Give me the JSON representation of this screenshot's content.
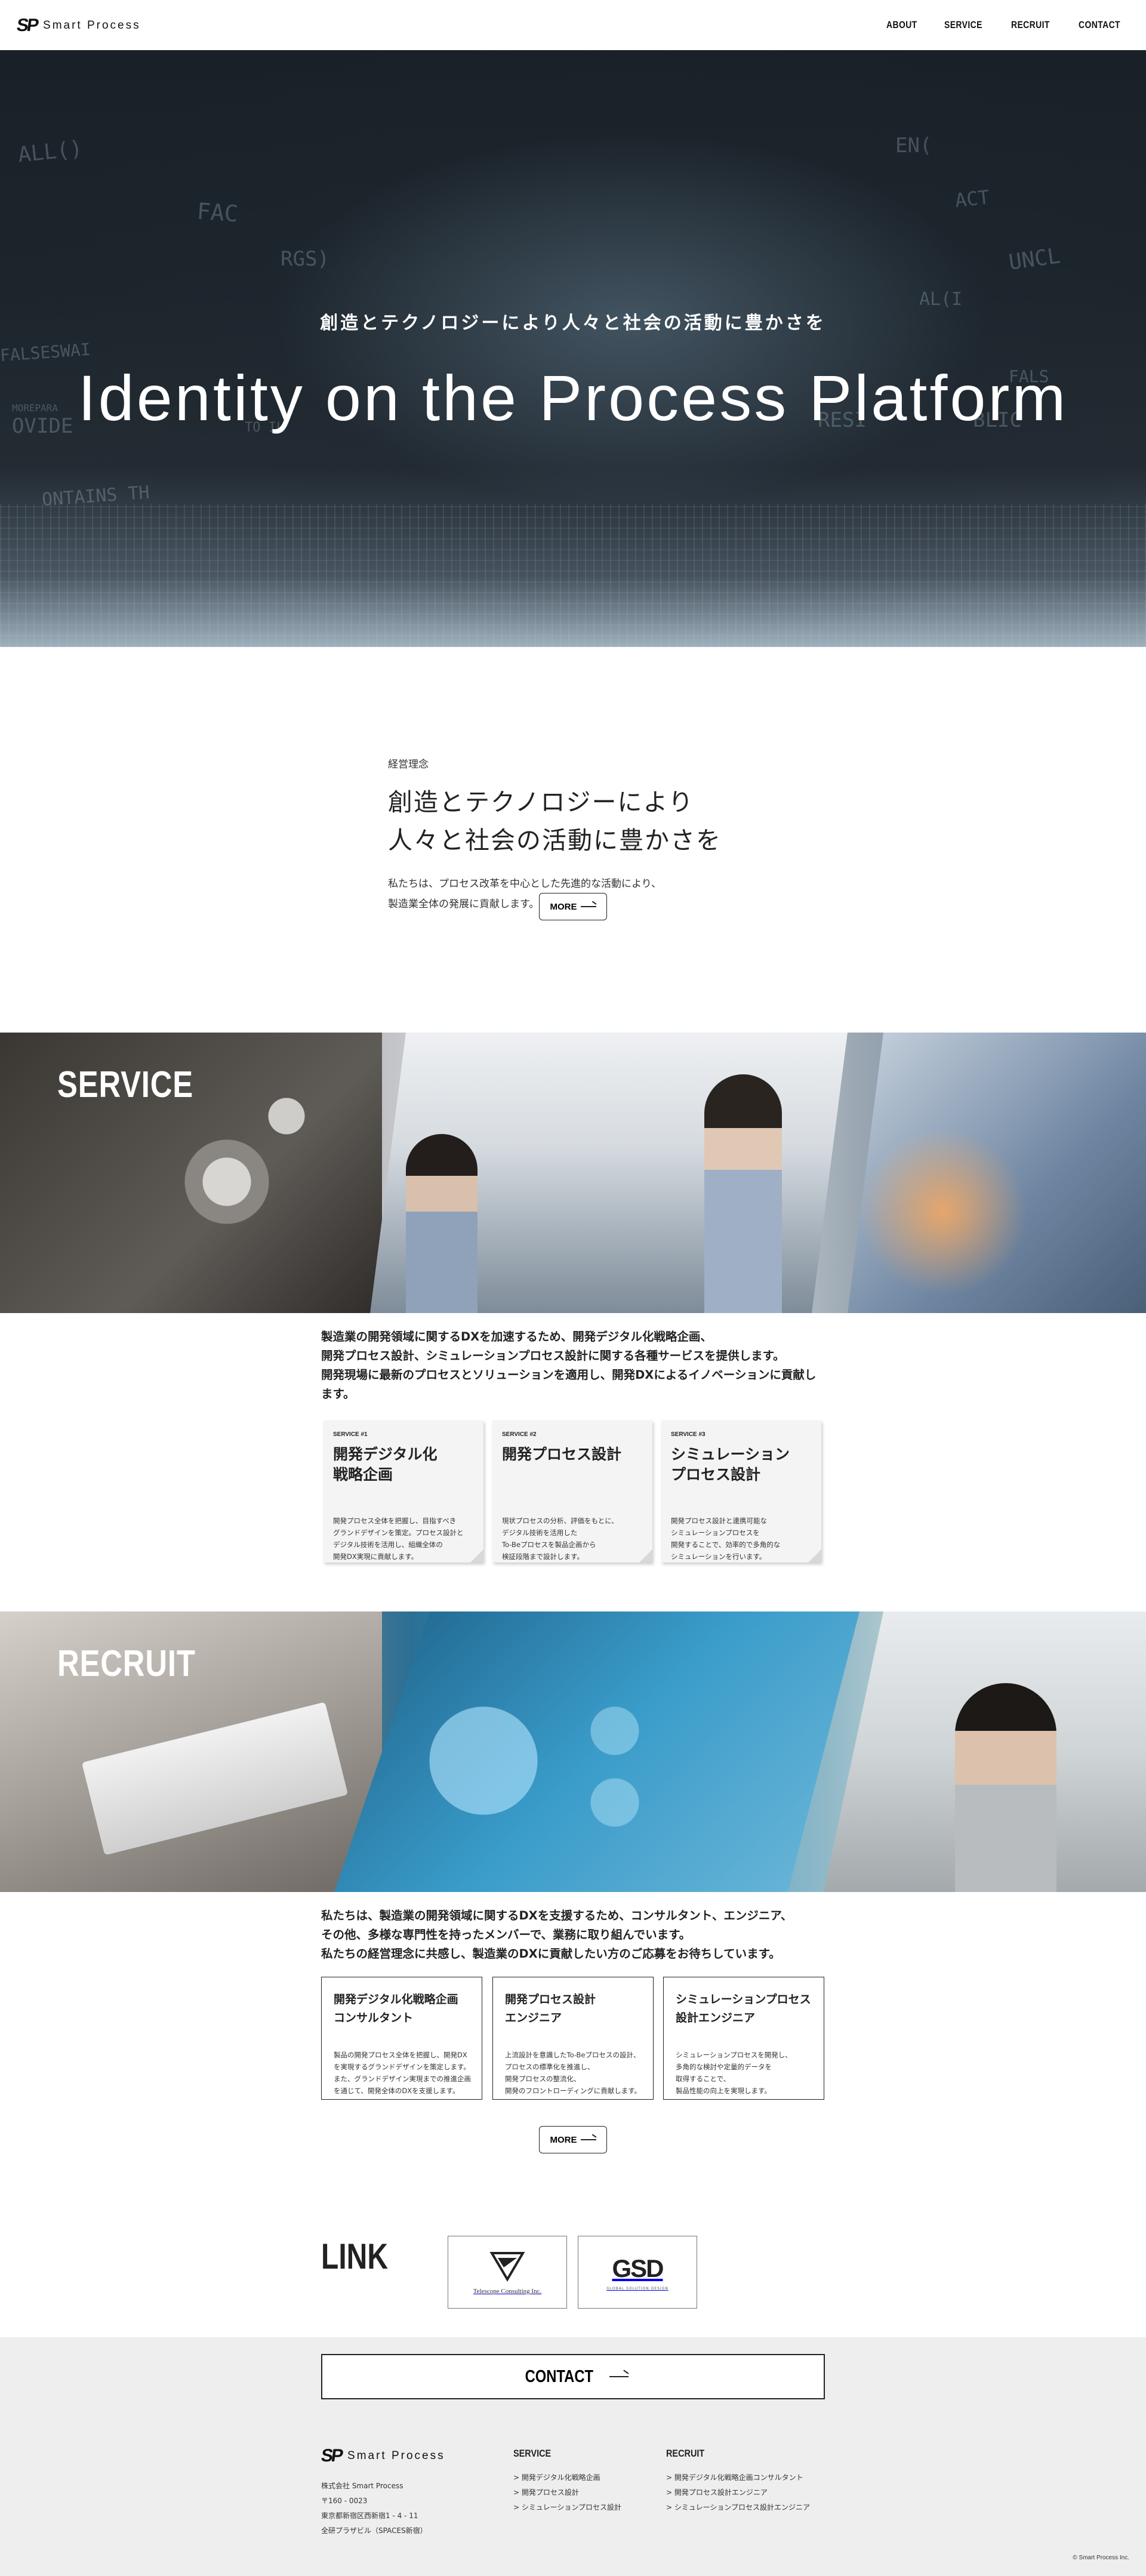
{
  "header": {
    "logo_mark": "SP",
    "logo_text": "Smart Process",
    "nav": [
      "ABOUT",
      "SERVICE",
      "RECRUIT",
      "CONTACT"
    ]
  },
  "hero": {
    "subtitle": "創造とテクノロジーにより人々と社会の活動に豊かさを",
    "title": "Identity on the Process Platform",
    "bg_text": [
      "ALL()",
      "FAC",
      "RGS)",
      "FALSESWAI",
      "OVIDE",
      "MOREPARA",
      "ONTAINS TH",
      "TO IL",
      "AL(I",
      "RESI",
      "BLIC",
      "EN(",
      "UNCL",
      "FALS",
      "ACT"
    ]
  },
  "philosophy": {
    "label": "経営理念",
    "heading_line1": "創造とテクノロジーにより",
    "heading_line2": "人々と社会の活動に豊かさを",
    "body_line1": "私たちは、プロセス改革を中心とした先進的な活動により、",
    "body_line2": "製造業全体の発展に貢献します。",
    "more_label": "MORE"
  },
  "service": {
    "banner_title": "SERVICE",
    "lead_line1": "製造業の開発領域に関するDXを加速するため、開発デジタル化戦略企画、",
    "lead_line2": "開発プロセス設計、シミュレーションプロセス設計に関する各種サービスを提供します。",
    "lead_line3": "開発現場に最新のプロセスとソリューションを適用し、開発DXによるイノベーションに貢献し",
    "lead_line4": "ます。",
    "cards": [
      {
        "num": "SERVICE #1",
        "title_line1": "開発デジタル化",
        "title_line2": "戦略企画",
        "desc": [
          "開発プロセス全体を把握し、目指すべき",
          "グランドデザインを策定。プロセス設計と",
          "デジタル技術を活用し、組織全体の",
          "開発DX実現に貢献します。"
        ]
      },
      {
        "num": "SERVICE #2",
        "title_line1": "開発プロセス設計",
        "title_line2": "",
        "desc": [
          "現状プロセスの分析、評価をもとに、",
          "デジタル技術を活用した",
          "To-Beプロセスを製品企画から",
          "検証段階まで設計します。"
        ]
      },
      {
        "num": "SERVICE #3",
        "title_line1": "シミュレーション",
        "title_line2": "プロセス設計",
        "desc": [
          "開発プロセス設計と連携可能な",
          "シミュレーションプロセスを",
          "開発することで、効率的で多角的な",
          "シミュレーションを行います。"
        ]
      }
    ]
  },
  "recruit": {
    "banner_title": "RECRUIT",
    "lead_line1": "私たちは、製造業の開発領域に関するDXを支援するため、コンサルタント、エンジニア、",
    "lead_line2": "その他、多様な専門性を持ったメンバーで、業務に取り組んでいます。",
    "lead_line3": "私たちの経営理念に共感し、製造業のDXに貢献したい方のご応募をお待ちしています。",
    "jobs": [
      {
        "title_line1": "開発デジタル化戦略企画",
        "title_line2": "コンサルタント",
        "desc": [
          "製品の開発プロセス全体を把握し、開発DX",
          "を実現するグランドデザインを策定します。",
          "また、グランドデザイン実現までの推進企画",
          "を通じて、開発全体のDXを支援します。"
        ]
      },
      {
        "title_line1": "開発プロセス設計",
        "title_line2": "エンジニア",
        "desc": [
          "上流設計を意識したTo-Beプロセスの設計、",
          "プロセスの標準化を推進し、",
          "開発プロセスの整流化、",
          "開発のフロントローディングに貢献します。"
        ]
      },
      {
        "title_line1": "シミュレーションプロセス",
        "title_line2": "設計エンジニア",
        "desc": [
          "シミュレーションプロセスを開発し、",
          "多角的な検討や定量的データを",
          "取得することで、",
          "製品性能の向上を実現します。"
        ]
      }
    ],
    "more_label": "MORE"
  },
  "link": {
    "title": "LINK",
    "partners": [
      {
        "name": "Telescope Consulting Inc."
      },
      {
        "name": "GSD",
        "sub": "GLOBAL SOLUTION DESIGN"
      }
    ]
  },
  "footer": {
    "contact_label": "CONTACT",
    "logo_mark": "SP",
    "logo_text": "Smart Process",
    "address": [
      "株式会社 Smart Process",
      "〒160 - 0023",
      "東京都新宿区西新宿1 - 4 - 11",
      "全研プラザビル（SPACES新宿）"
    ],
    "service_title": "SERVICE",
    "service_links": [
      "> 開発デジタル化戦略企画",
      "> 開発プロセス設計",
      "> シミュレーションプロセス設計"
    ],
    "recruit_title": "RECRUIT",
    "recruit_links": [
      "> 開発デジタル化戦略企画コンサルタント",
      "> 開発プロセス設計エンジニア",
      "> シミュレーションプロセス設計エンジニア"
    ],
    "copyright": "© Smart Process Inc."
  }
}
